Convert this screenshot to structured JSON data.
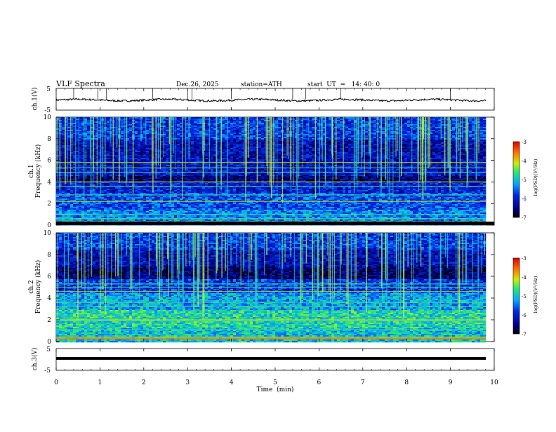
{
  "header": {
    "title": "VLF  Spectra",
    "date": "Dec.26, 2025",
    "station": "station=ATH",
    "start": "start  UT  =   14: 40: 0"
  },
  "chart_data": [
    {
      "type": "line",
      "panel": "ch1-waveform",
      "ylabel": "ch.1(V)",
      "ylim": [
        -5,
        5
      ],
      "yticks": [
        "5",
        "-5"
      ],
      "xlim": [
        0,
        10
      ],
      "baseline": 0,
      "spike_times_min": [
        0.4,
        0.95,
        1.15,
        2.2,
        3.0,
        3.1,
        4.0,
        5.4,
        5.7,
        6.5,
        9.0
      ]
    },
    {
      "type": "heatmap",
      "panel": "ch1-spectrogram",
      "ylabel": "ch.1\nFrequency (kHz)",
      "ylim": [
        0,
        10
      ],
      "yticks": [
        "0",
        "2",
        "4",
        "6",
        "8",
        "10"
      ],
      "xlim": [
        0,
        10
      ],
      "colorbar": {
        "label": "log(PSD)(V²/Hz)",
        "ticks": [
          "-3",
          "-4",
          "-5",
          "-6",
          "-7"
        ],
        "range": [
          -7,
          -3
        ]
      },
      "horizontal_lines_khz": [
        0.3,
        0.6,
        1.0,
        2.2,
        2.8,
        3.6,
        4.0,
        4.9,
        5.3,
        5.8
      ],
      "dark_band_khz": [
        4.1,
        4.6
      ]
    },
    {
      "type": "heatmap",
      "panel": "ch2-spectrogram",
      "ylabel": "ch.2\nFrequency (kHz)",
      "ylim": [
        0,
        10
      ],
      "yticks": [
        "0",
        "2",
        "4",
        "6",
        "8",
        "10"
      ],
      "xlim": [
        0,
        10
      ],
      "colorbar": {
        "label": "log(PSD)(V²/Hz)",
        "ticks": [
          "-3",
          "-4",
          "-5",
          "-6",
          "-7"
        ],
        "range": [
          -7,
          -3
        ]
      },
      "horizontal_lines_khz": [
        0.4,
        1.1,
        1.9,
        2.0,
        3.2,
        3.6,
        4.6,
        5.0,
        5.3
      ],
      "dark_band_khz": [
        5.8,
        7.0
      ]
    },
    {
      "type": "line",
      "panel": "ch3-waveform",
      "ylabel": "ch.3(V)",
      "ylim": [
        -5,
        5
      ],
      "yticks": [
        "5",
        "-5"
      ],
      "xlim": [
        0,
        10
      ],
      "baseline": 0,
      "xlabel": "Time  (min)",
      "xticks": [
        "0",
        "1",
        "2",
        "3",
        "4",
        "5",
        "6",
        "7",
        "8",
        "9",
        "10"
      ]
    }
  ]
}
